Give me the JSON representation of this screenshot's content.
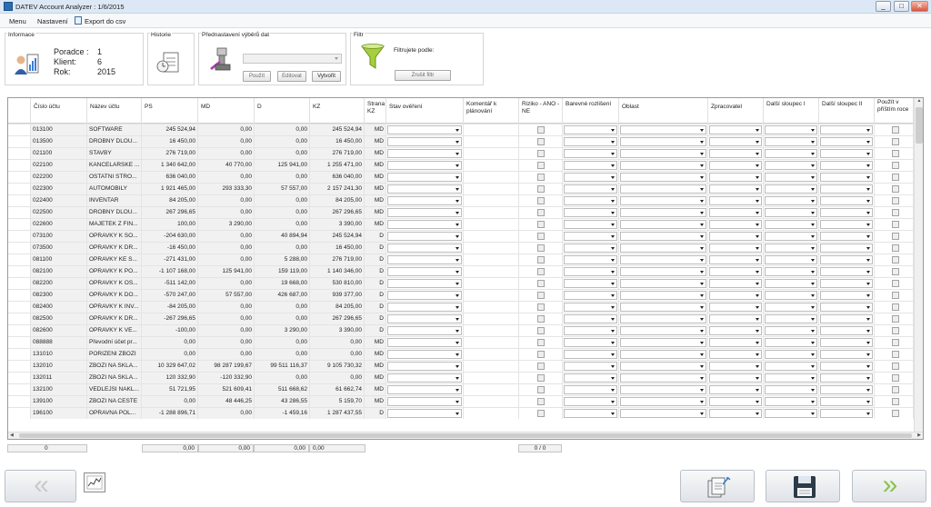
{
  "window": {
    "title": "DATEV Account Analyzer : 1/6/2015",
    "minimize": "_",
    "maximize": "□",
    "close": "✕"
  },
  "menu": {
    "items": [
      "Menu",
      "Nastavení",
      "Export do csv"
    ]
  },
  "info": {
    "title": "Informace",
    "poradce_label": "Poradce :",
    "poradce_value": "1",
    "klient_label": "Klient:",
    "klient_value": "6",
    "rok_label": "Rok:",
    "rok_value": "2015"
  },
  "historie": {
    "title": "Historie"
  },
  "prednastaveni": {
    "title": "Přednastavení výběrů dat",
    "select_value": "",
    "pouzit": "Použít",
    "editovat": "Editovat",
    "vytvorit": "Vytvořit"
  },
  "filtr": {
    "title": "Filtr",
    "filter_by_label": "Filtrujete podle:",
    "clear_button": "Zrušit filtr"
  },
  "icons": {
    "user": "user-chart-icon",
    "history": "clock-document-icon",
    "preset": "robot-arm-icon",
    "filter": "funnel-icon",
    "chart": "line-chart-icon",
    "export": "documents-export-icon",
    "save": "floppy-disk-icon"
  },
  "colors": {
    "selection": "#cfe3f7",
    "arrows": "#8bc34a",
    "gridline": "#e4e4e4"
  },
  "grid": {
    "columns": [
      "Číslo účtu",
      "Název účtu",
      "PS",
      "MD",
      "D",
      "KZ",
      "Strana KZ",
      "Stav ověření",
      "Komentář k plánování",
      "Riziko - ANO - NE",
      "Barevné rozlišení",
      "Oblast",
      "Zpracovatel",
      "Další sloupec I",
      "Další sloupec II",
      "Použít v příštím roce"
    ],
    "rows": [
      {
        "ucet": "013100",
        "nazev": "SOFTWARE",
        "ps": "245 524,94",
        "md": "0,00",
        "d": "0,00",
        "kz": "245 524,94",
        "strana": "MD"
      },
      {
        "ucet": "013500",
        "nazev": "DROBNY DLOU...",
        "ps": "16 450,00",
        "md": "0,00",
        "d": "0,00",
        "kz": "16 450,00",
        "strana": "MD"
      },
      {
        "ucet": "021100",
        "nazev": "STAVBY",
        "ps": "276 719,00",
        "md": "0,00",
        "d": "0,00",
        "kz": "276 719,00",
        "strana": "MD"
      },
      {
        "ucet": "022100",
        "nazev": "KANCELARSKE ...",
        "ps": "1 340 642,00",
        "md": "40 770,00",
        "d": "125 941,00",
        "kz": "1 255 471,00",
        "strana": "MD"
      },
      {
        "ucet": "022200",
        "nazev": "OSTATNI STRO...",
        "ps": "636 040,00",
        "md": "0,00",
        "d": "0,00",
        "kz": "636 040,00",
        "strana": "MD"
      },
      {
        "ucet": "022300",
        "nazev": "AUTOMOBILY",
        "ps": "1 921 465,00",
        "md": "293 333,30",
        "d": "57 557,00",
        "kz": "2 157 241,30",
        "strana": "MD"
      },
      {
        "ucet": "022400",
        "nazev": "INVENTAR",
        "ps": "84 205,00",
        "md": "0,00",
        "d": "0,00",
        "kz": "84 205,00",
        "strana": "MD"
      },
      {
        "ucet": "022500",
        "nazev": "DROBNY DLOU...",
        "ps": "267 296,65",
        "md": "0,00",
        "d": "0,00",
        "kz": "267 296,65",
        "strana": "MD"
      },
      {
        "ucet": "022600",
        "nazev": "MAJETEK Z FIN...",
        "ps": "100,00",
        "md": "3 290,00",
        "d": "0,00",
        "kz": "3 390,00",
        "strana": "MD"
      },
      {
        "ucet": "073100",
        "nazev": "OPRAVKY K SO...",
        "ps": "-204 630,00",
        "md": "0,00",
        "d": "40 894,94",
        "kz": "245 524,94",
        "strana": "D"
      },
      {
        "ucet": "073500",
        "nazev": "OPRAVKY K DR...",
        "ps": "-16 450,00",
        "md": "0,00",
        "d": "0,00",
        "kz": "16 450,00",
        "strana": "D"
      },
      {
        "ucet": "081100",
        "nazev": "OPRAVKY KE S...",
        "ps": "-271 431,00",
        "md": "0,00",
        "d": "5 288,00",
        "kz": "276 719,00",
        "strana": "D"
      },
      {
        "ucet": "082100",
        "nazev": "OPRAVKY K PO...",
        "ps": "-1 107 168,00",
        "md": "125 941,00",
        "d": "159 119,00",
        "kz": "1 140 346,00",
        "strana": "D"
      },
      {
        "ucet": "082200",
        "nazev": "OPRAVKY K OS...",
        "ps": "-511 142,00",
        "md": "0,00",
        "d": "19 668,00",
        "kz": "530 810,00",
        "strana": "D"
      },
      {
        "ucet": "082300",
        "nazev": "OPRAVKY K DO...",
        "ps": "-570 247,00",
        "md": "57 557,00",
        "d": "426 687,00",
        "kz": "939 377,00",
        "strana": "D"
      },
      {
        "ucet": "082400",
        "nazev": "OPRAVKY K INV...",
        "ps": "-84 205,00",
        "md": "0,00",
        "d": "0,00",
        "kz": "84 205,00",
        "strana": "D"
      },
      {
        "ucet": "082500",
        "nazev": "OPRAVKY K DR...",
        "ps": "-267 296,65",
        "md": "0,00",
        "d": "0,00",
        "kz": "267 296,65",
        "strana": "D"
      },
      {
        "ucet": "082600",
        "nazev": "OPRAVKY K VE...",
        "ps": "-100,00",
        "md": "0,00",
        "d": "3 290,00",
        "kz": "3 390,00",
        "strana": "D"
      },
      {
        "ucet": "088888",
        "nazev": "Převodní účet pr...",
        "ps": "0,00",
        "md": "0,00",
        "d": "0,00",
        "kz": "0,00",
        "strana": "MD"
      },
      {
        "ucet": "131010",
        "nazev": "PORIZENI ZBOZI",
        "ps": "0,00",
        "md": "0,00",
        "d": "0,00",
        "kz": "0,00",
        "strana": "MD"
      },
      {
        "ucet": "132010",
        "nazev": "ZBOZI NA SKLA...",
        "ps": "10 329 647,02",
        "md": "98 287 199,67",
        "d": "99 511 116,37",
        "kz": "9 105 730,32",
        "strana": "MD"
      },
      {
        "ucet": "132011",
        "nazev": "ZBOZI NA SKLA...",
        "ps": "120 332,90",
        "md": "-120 332,90",
        "d": "0,00",
        "kz": "0,00",
        "strana": "MD"
      },
      {
        "ucet": "132100",
        "nazev": "VEDLEJSI NAKL...",
        "ps": "51 721,95",
        "md": "521 609,41",
        "d": "511 668,62",
        "kz": "61 662,74",
        "strana": "MD"
      },
      {
        "ucet": "139100",
        "nazev": "ZBOZI NA CESTE",
        "ps": "0,00",
        "md": "48 446,25",
        "d": "43 286,55",
        "kz": "5 159,70",
        "strana": "MD"
      },
      {
        "ucet": "196100",
        "nazev": "OPRAVNA POL...",
        "ps": "-1 288 896,71",
        "md": "0,00",
        "d": "-1 459,16",
        "kz": "1 287 437,55",
        "strana": "D"
      }
    ]
  },
  "summary": {
    "count": "0",
    "ps": "0,00",
    "md": "0,00",
    "d": "0,00",
    "kz": "0,00",
    "riziko": "0 / 0"
  },
  "nav": {
    "prev": "«",
    "next": "»"
  }
}
